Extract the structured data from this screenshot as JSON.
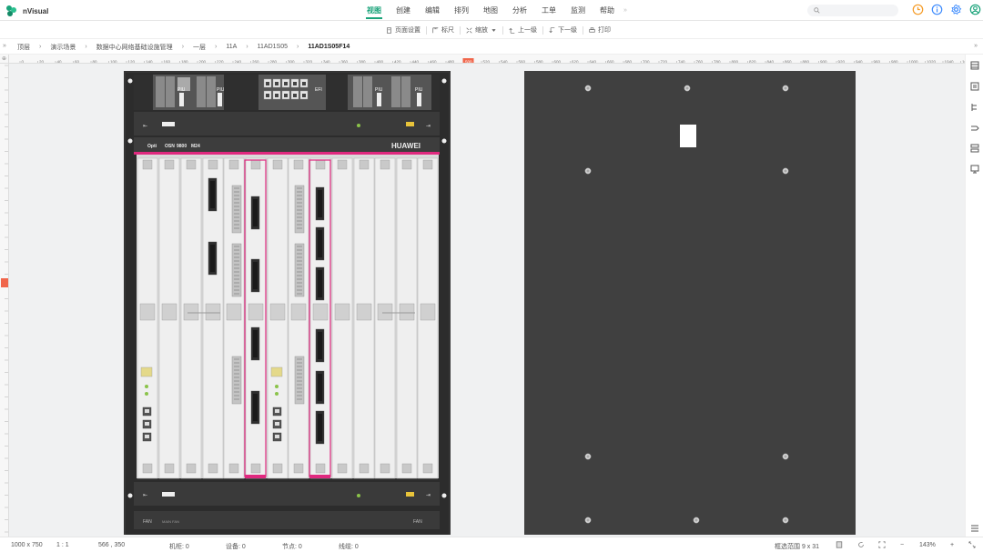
{
  "app": {
    "name": "nVisual"
  },
  "menu": {
    "items": [
      {
        "label": "视图",
        "active": true
      },
      {
        "label": "创建",
        "active": false
      },
      {
        "label": "编辑",
        "active": false
      },
      {
        "label": "排列",
        "active": false
      },
      {
        "label": "地图",
        "active": false
      },
      {
        "label": "分析",
        "active": false
      },
      {
        "label": "工单",
        "active": false
      },
      {
        "label": "监测",
        "active": false
      },
      {
        "label": "帮助",
        "active": false
      }
    ],
    "more": "»"
  },
  "search": {
    "placeholder": ""
  },
  "header_icons": [
    {
      "name": "time-icon",
      "color": "#f59a23"
    },
    {
      "name": "info-icon",
      "color": "#3d8bfd"
    },
    {
      "name": "settings-icon",
      "color": "#3d8bfd"
    },
    {
      "name": "user-icon",
      "color": "#1aa37a"
    }
  ],
  "toolbar": {
    "page_setup": "页面设置",
    "ruler": "标尺",
    "zoom": "缩放",
    "up_level": "上一级",
    "down_level": "下一级",
    "print": "打印"
  },
  "breadcrumb": {
    "collapse": "»",
    "items": [
      "顶层",
      "演示场景",
      "数据中心网络基础设施管理",
      "一层",
      "11A",
      "11AD1S05",
      "11AD1S05F14"
    ],
    "separator": "›",
    "right": "»"
  },
  "ruler": {
    "h_labels": [
      "0",
      "20",
      "40",
      "60",
      "80",
      "100",
      "120",
      "140",
      "160",
      "180",
      "200",
      "220",
      "240",
      "260",
      "280",
      "300",
      "320",
      "340",
      "360",
      "380",
      "400",
      "420",
      "440",
      "460",
      "480",
      "500",
      "520",
      "540",
      "560",
      "580",
      "600",
      "620",
      "640",
      "660",
      "680",
      "700",
      "720",
      "740",
      "760",
      "780",
      "800",
      "820",
      "840",
      "860",
      "880",
      "900",
      "920",
      "940",
      "960",
      "980",
      "1000",
      "1020",
      "1040",
      "1060",
      "1080",
      "1100",
      "1120"
    ],
    "marker": "500"
  },
  "device": {
    "brand": "HUAWEI",
    "model_prefix": "Opti",
    "model_mid": "OSN",
    "model_num": "9800",
    "model_suffix": "M24",
    "piu_label": "PIU",
    "efi_label": "EFI",
    "fan_label": "FAN",
    "fan_code": "MAIN FAN"
  },
  "colors": {
    "accent": "#1aa37a",
    "chassis": "#3c3c3c",
    "panel": "#404040",
    "highlight_pink": "#e0297f",
    "marker_red": "#f0664b"
  },
  "status": {
    "canvas_size": "1000 x 750",
    "ratio": "1 : 1",
    "coords": "566 , 350",
    "racks": "机柜: 0",
    "devices": "设备: 0",
    "nodes": "节点: 0",
    "links": "线缆: 0",
    "selection": "框选范围 9 x 31",
    "zoom": "143%",
    "zoom_minus": "−",
    "zoom_plus": "+"
  }
}
